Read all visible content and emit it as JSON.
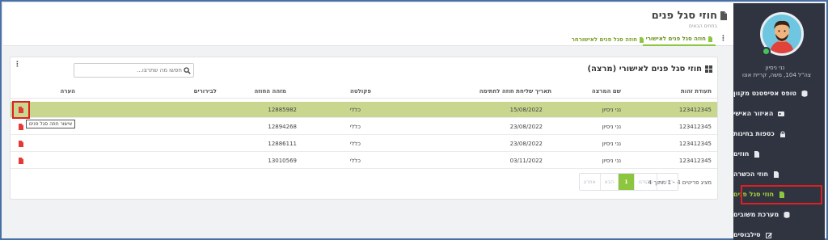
{
  "header": {
    "title": "חוזי סגל פנים",
    "subtitle": "בחוזים הבאים",
    "tabs": [
      {
        "label": "חוזה סגל פנים לאישורי"
      },
      {
        "label": "חוזה סגל פנים לאישורחר"
      }
    ],
    "kebab": "⋮"
  },
  "sidebar": {
    "user_name": "נני ניסיון",
    "user_address": "צה\"ל 104, משה, קריית אונו",
    "items": [
      {
        "label": "טופס אסיסטנט מקוון",
        "icon": "database-icon"
      },
      {
        "label": "האיזור האישי",
        "icon": "id-card-icon"
      },
      {
        "label": "כספות בחינות",
        "icon": "lock-icon"
      },
      {
        "label": "חוזים",
        "icon": "file-icon"
      },
      {
        "label": "חוזי הכשרה",
        "icon": "file-icon"
      },
      {
        "label": "חוזי סגל פנים",
        "icon": "file-green-icon"
      },
      {
        "label": "מערכת משובים",
        "icon": "database-icon"
      },
      {
        "label": "סילבוסים",
        "icon": "edit-icon"
      }
    ],
    "active_index": 5
  },
  "card": {
    "title": "חוזי סגל פנים לאישורי (מרצה)",
    "kebab": "⋮",
    "search_placeholder": "חפשו מה שתרצו...",
    "columns": [
      "תעודת זהות",
      "שם המרצה",
      "תאריך שליחת חוזה לחתימה",
      "פקולטה",
      "מזהה החוזה",
      "לבירורים",
      "הערה"
    ],
    "rows": [
      {
        "id": "123412345",
        "lecturer": "נני ניסיון",
        "date": "15/08/2022",
        "faculty": "כללי",
        "contract_id": "12885982"
      },
      {
        "id": "123412345",
        "lecturer": "נני ניסיון",
        "date": "23/08/2022",
        "faculty": "כללי",
        "contract_id": "12894268"
      },
      {
        "id": "123412345",
        "lecturer": "נני ניסיון",
        "date": "23/08/2022",
        "faculty": "כללי",
        "contract_id": "12886111"
      },
      {
        "id": "123412345",
        "lecturer": "נני ניסיון",
        "date": "03/11/2022",
        "faculty": "כללי",
        "contract_id": "13010569"
      }
    ],
    "tooltip": "אישור חוזה סגל פנים",
    "show_count": "מציג פריטים 4 - 1 מתוך 4",
    "pager": {
      "first": "ראשון",
      "prev": "הקודם",
      "current": "1",
      "next": "הבא",
      "last": "אחרון"
    }
  },
  "colors": {
    "accent": "#8cc63f",
    "sidebar_bg": "#2f3440",
    "selected_row": "#c8d68e",
    "highlight": "#e02020",
    "pdf": "#e53935"
  }
}
